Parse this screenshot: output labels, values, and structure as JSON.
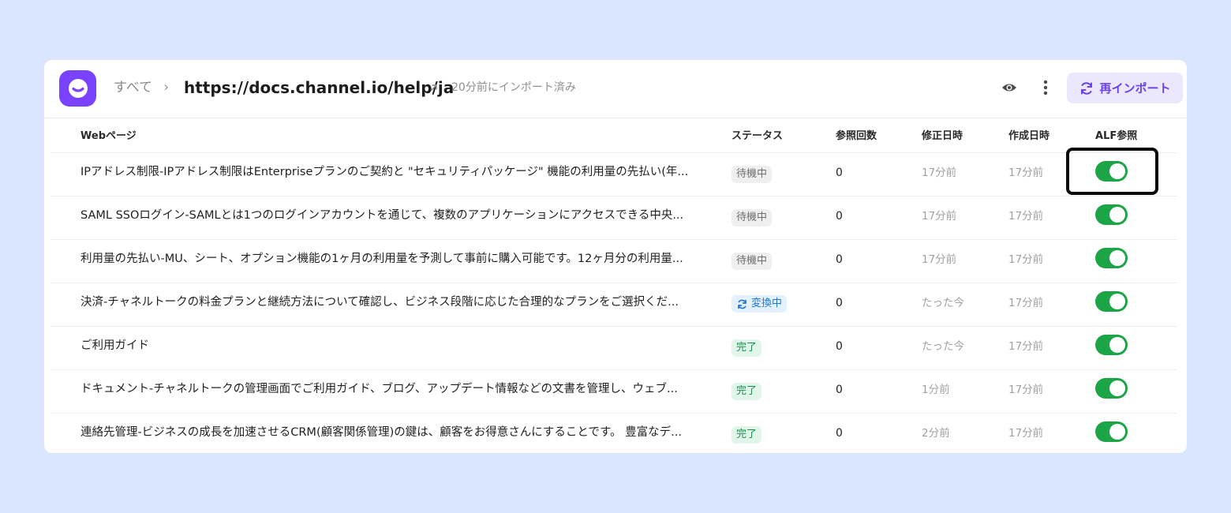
{
  "header": {
    "breadcrumb_all": "すべて",
    "breadcrumb_separator": "›",
    "url": "https://docs.channel.io/help/ja",
    "import_status": "20分前にインポート済み",
    "reimport_label": "再インポート"
  },
  "columns": {
    "webpage": "Webページ",
    "status": "ステータス",
    "references": "参照回数",
    "modified": "修正日時",
    "created": "作成日時",
    "alf": "ALF参照"
  },
  "rows": [
    {
      "title": "IPアドレス制限-IPアドレス制限はEnterpriseプランのご契約と \"セキュリティパッケージ\" 機能の利用量の先払い(年...",
      "status": "待機中",
      "count": "0",
      "modified": "17分前",
      "created": "17分前"
    },
    {
      "title": "SAML SSOログイン-SAMLとは1つのログインアカウントを通じて、複数のアプリケーションにアクセスできる中央...",
      "status": "待機中",
      "count": "0",
      "modified": "17分前",
      "created": "17分前"
    },
    {
      "title": "利用量の先払い-MU、シート、オプション機能の1ヶ月の利用量を予測して事前に購入可能です。12ヶ月分の利用量...",
      "status": "待機中",
      "count": "0",
      "modified": "17分前",
      "created": "17分前"
    },
    {
      "title": "決済-チャネルトークの料金プランと継続方法について確認し、ビジネス段階に応じた合理的なプランをご選択くだ...",
      "status": "変換中",
      "count": "0",
      "modified": "たった今",
      "created": "17分前"
    },
    {
      "title": "ご利用ガイド",
      "status": "完了",
      "count": "0",
      "modified": "たった今",
      "created": "17分前"
    },
    {
      "title": "ドキュメント-チャネルトークの管理画面でご利用ガイド、ブログ、アップデート情報などの文書を管理し、ウェブ...",
      "status": "完了",
      "count": "0",
      "modified": "1分前",
      "created": "17分前"
    },
    {
      "title": "連絡先管理-ビジネスの成長を加速させるCRM(顧客関係管理)の鍵は、顧客をお得意さんにすることです。 豊富なデ...",
      "status": "完了",
      "count": "0",
      "modified": "2分前",
      "created": "17分前"
    }
  ],
  "toggles_on": [
    true,
    true,
    true,
    true,
    true,
    true,
    true
  ],
  "colors": {
    "brand": "#7a42ff",
    "toggle_on": "#1ba546",
    "converting": "#1f76d2",
    "done": "#1c8f4b"
  },
  "icons": {
    "logo": "channel-talk-logo-icon",
    "external": "external-link-icon",
    "preview": "eye-icon",
    "more": "more-vertical-icon",
    "reimport": "refresh-icon"
  }
}
